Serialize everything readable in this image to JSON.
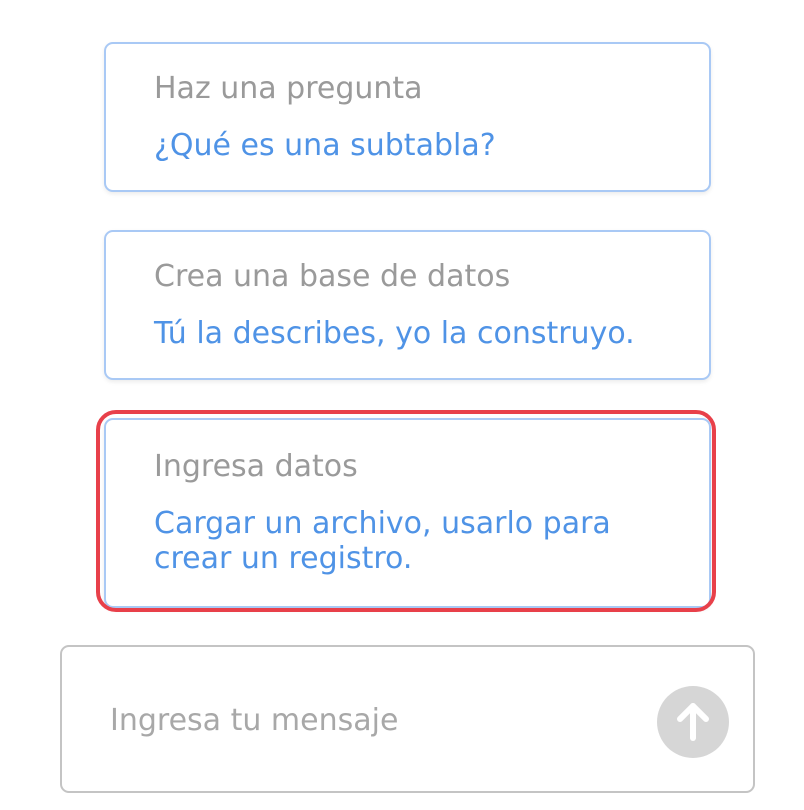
{
  "suggestions": [
    {
      "title": "Haz una pregunta",
      "description_lines": [
        "¿Qué es una subtabla?"
      ]
    },
    {
      "title": "Crea una base de datos",
      "description_lines": [
        "Tú la describes, yo la construyo."
      ]
    },
    {
      "title": "Ingresa datos",
      "description_lines": [
        "Cargar un archivo, usarlo para",
        "crear un registro."
      ]
    }
  ],
  "message": {
    "placeholder": "Ingresa tu mensaje",
    "value": ""
  },
  "send_button": {
    "icon": "arrow-up-icon"
  },
  "colors": {
    "card_border": "#a9c9f5",
    "title_text": "#9a9a9a",
    "link_text": "#4f93e6",
    "highlight": "#e8404a",
    "send_button_bg": "#d6d6d6"
  }
}
